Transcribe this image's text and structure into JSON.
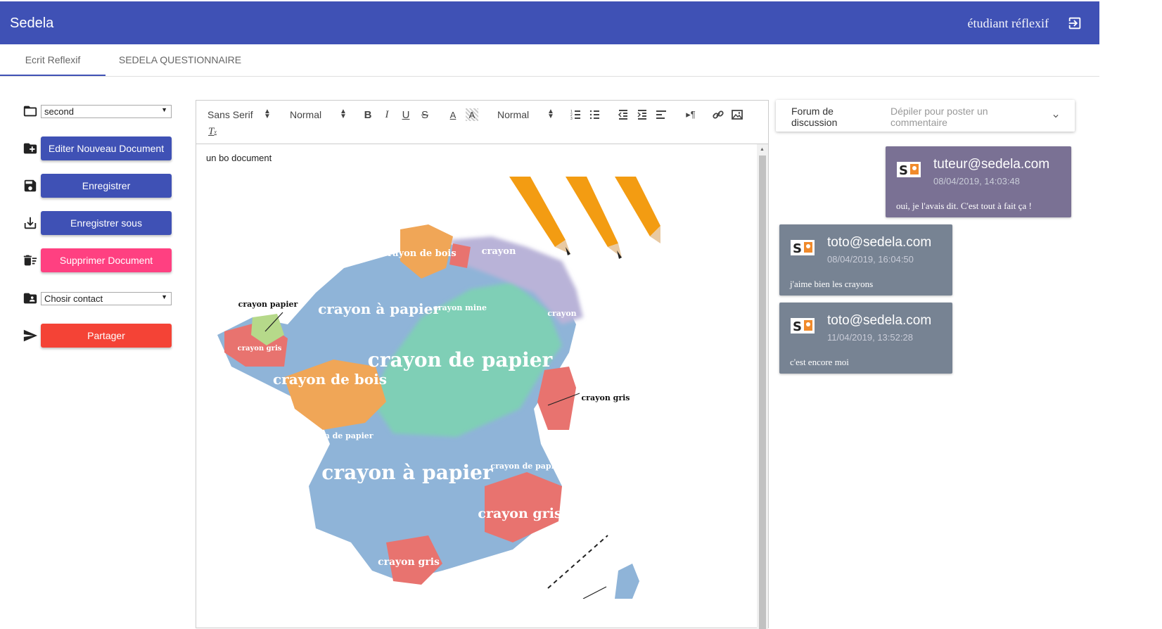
{
  "app": {
    "title": "Sedela",
    "user": "étudiant réflexif",
    "colors": {
      "primary": "#3f51b5",
      "accent": "#ff4081",
      "danger": "#f44336",
      "tutor_card": "#7a7194",
      "student_card": "#778393"
    }
  },
  "tabs": [
    {
      "label": "Ecrit Reflexif",
      "active": true
    },
    {
      "label": "SEDELA QUESTIONNAIRE",
      "active": false
    }
  ],
  "left_panel": {
    "document_select": "second",
    "buttons": {
      "new_doc": "Editer Nouveau Document",
      "save": "Enregistrer",
      "save_as": "Enregistrer sous",
      "delete": "Supprimer Document",
      "share": "Partager"
    },
    "contact_select": "Chosir contact"
  },
  "editor": {
    "toolbar": {
      "font": "Sans Serif",
      "size": "Normal",
      "heading": "Normal"
    },
    "content_text": "un bo document",
    "image_labels": [
      "crayon papier",
      "crayon gris",
      "crayon à papier",
      "crayon de bois",
      "crayon",
      "crayon mine",
      "crayon de papier",
      "crayon gris",
      "crayon de papier",
      "crayon à papier",
      "crayon de papier",
      "crayon gris",
      "crayon gris",
      "crayon de bois",
      "crayon",
      "crayon"
    ]
  },
  "forum": {
    "title": "Forum de discussion",
    "subtitle": "Dépiler pour poster un commentaire",
    "messages": [
      {
        "author": "tuteur@sedela.com",
        "date": "08/04/2019, 14:03:48",
        "text": "oui, je l'avais dit. C'est tout à fait ça !"
      },
      {
        "author": "toto@sedela.com",
        "date": "08/04/2019, 16:04:50",
        "text": "j'aime bien les crayons"
      },
      {
        "author": "toto@sedela.com",
        "date": "11/04/2019, 13:52:28",
        "text": "c'est encore moi"
      }
    ]
  }
}
